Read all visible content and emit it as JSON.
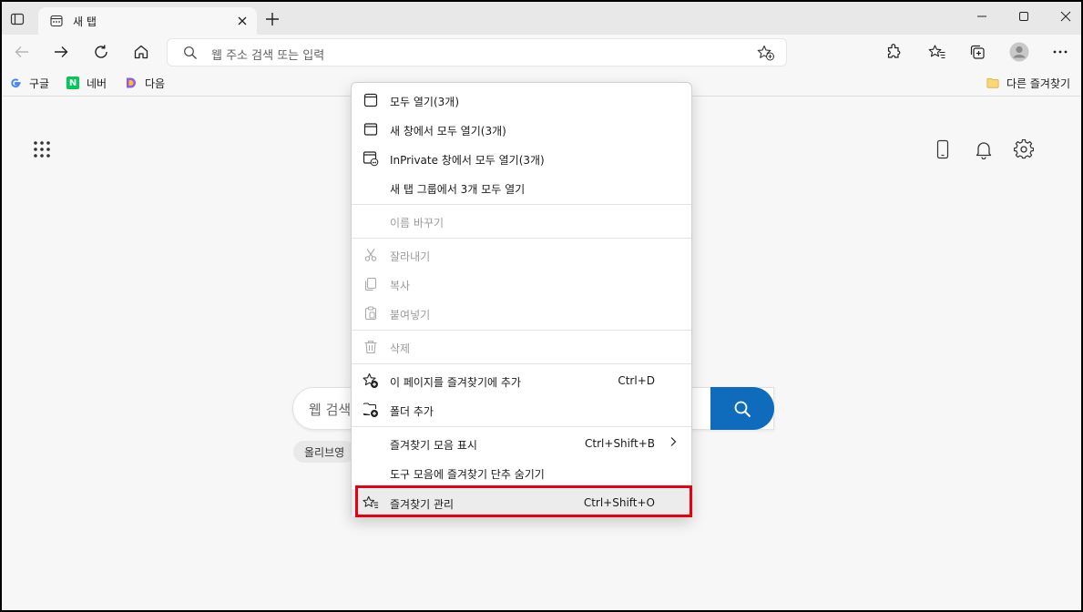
{
  "tab": {
    "title": "새 탭"
  },
  "address": {
    "placeholder": "웹 주소 검색 또는 입력"
  },
  "bookmarks": {
    "items": [
      {
        "label": "구글",
        "icon": "google-icon"
      },
      {
        "label": "네버",
        "icon": "naver-icon"
      },
      {
        "label": "다음",
        "icon": "daum-icon"
      }
    ],
    "other_label": "다른 즐겨찾기"
  },
  "page": {
    "search_placeholder": "웹 검색",
    "chip_label": "올리브영"
  },
  "menu": {
    "open_all": "모두 열기(3개)",
    "open_all_new_window": "새 창에서 모두 열기(3개)",
    "open_all_inprivate": "InPrivate 창에서 모두 열기(3개)",
    "open_all_tab_group": "새 탭 그룹에서 3개 모두 열기",
    "rename": "이름 바꾸기",
    "cut": "잘라내기",
    "copy": "복사",
    "paste": "붙여넣기",
    "delete": "삭제",
    "add_page": "이 페이지를 즐겨찾기에 추가",
    "add_page_shortcut": "Ctrl+D",
    "add_folder": "폴더 추가",
    "show_bar": "즐겨찾기 모음 표시",
    "show_bar_shortcut": "Ctrl+Shift+B",
    "hide_button": "도구 모음에 즐겨찾기 단추 숨기기",
    "manage": "즐겨찾기 관리",
    "manage_shortcut": "Ctrl+Shift+O"
  },
  "colors": {
    "accent": "#0f6cbd",
    "highlight_border": "#e60012"
  }
}
